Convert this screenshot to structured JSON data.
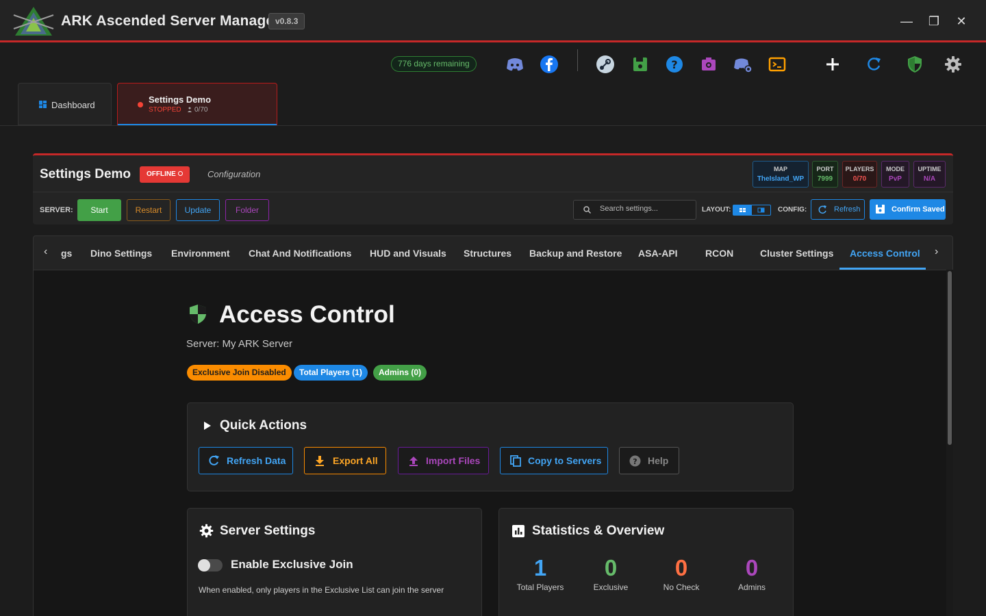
{
  "app": {
    "title": "ARK Ascended Server Manager",
    "version": "v0.8.3"
  },
  "window_controls": {
    "minimize": "—",
    "maximize": "❐",
    "close": "✕"
  },
  "toolbar": {
    "days_remaining": "776 days remaining",
    "icons": [
      "discord-icon",
      "facebook-icon",
      "steam-icon",
      "save-icon",
      "help-icon",
      "camera-icon",
      "discord-bot-icon",
      "terminal-icon",
      "add-icon",
      "refresh-icon",
      "shield-icon",
      "settings-icon"
    ]
  },
  "server_tabs": {
    "dashboard": "Dashboard",
    "active": {
      "name": "Settings Demo",
      "status": "STOPPED",
      "players": "0/70"
    }
  },
  "server_header": {
    "name": "Settings Demo",
    "status_badge": "OFFLINE",
    "subtitle": "Configuration",
    "stats": [
      {
        "key": "MAP",
        "value": "TheIsland_WP",
        "color": "#42a5f5"
      },
      {
        "key": "PORT",
        "value": "7999",
        "color": "#66bb6a"
      },
      {
        "key": "PLAYERS",
        "value": "0/70",
        "color": "#ef5350"
      },
      {
        "key": "MODE",
        "value": "PvP",
        "color": "#ab47bc"
      },
      {
        "key": "UPTIME",
        "value": "N/A",
        "color": "#ab47bc"
      }
    ],
    "server_label": "SERVER:",
    "buttons": {
      "start": "Start",
      "restart": "Restart",
      "update": "Update",
      "folder": "Folder"
    },
    "search_placeholder": "Search settings...",
    "layout_label": "LAYOUT:",
    "config_label": "CONFIG:",
    "refresh": "Refresh",
    "confirm": "Confirm Saved"
  },
  "settings_tabs": {
    "partial": "gs",
    "items": [
      "Dino Settings",
      "Environment",
      "Chat And Notifications",
      "HUD and Visuals",
      "Structures",
      "Backup and Restore",
      "ASA-API",
      "RCON",
      "Cluster Settings",
      "Access Control"
    ],
    "active": "Access Control"
  },
  "page": {
    "title": "Access Control",
    "subtitle": "Server: My ARK Server",
    "pills": [
      {
        "label": "Exclusive Join Disabled",
        "color": "#fb8c00"
      },
      {
        "label": "Total Players (1)",
        "color": "#1e88e5"
      },
      {
        "label": "Admins (0)",
        "color": "#43a047"
      }
    ]
  },
  "quick_actions": {
    "title": "Quick Actions",
    "buttons": {
      "refresh": "Refresh Data",
      "export": "Export All",
      "import": "Import Files",
      "copy": "Copy to Servers",
      "help": "Help"
    }
  },
  "server_settings": {
    "title": "Server Settings",
    "toggle_label": "Enable Exclusive Join",
    "toggle_on": false,
    "toggle_desc": "When enabled, only players in the Exclusive List can join the server"
  },
  "statistics": {
    "title": "Statistics & Overview",
    "items": [
      {
        "value": "1",
        "label": "Total Players",
        "color": "#42a5f5"
      },
      {
        "value": "0",
        "label": "Exclusive",
        "color": "#66bb6a"
      },
      {
        "value": "0",
        "label": "No Check",
        "color": "#ff7043"
      },
      {
        "value": "0",
        "label": "Admins",
        "color": "#ab47bc"
      }
    ]
  }
}
